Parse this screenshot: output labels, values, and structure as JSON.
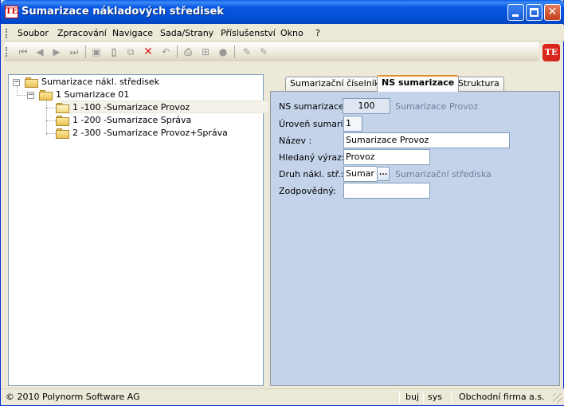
{
  "window": {
    "title": "Sumarizace nákladových středisek",
    "app_icon_text": "TE",
    "buttons": {
      "minimize": "",
      "maximize": "",
      "close": "✕"
    }
  },
  "menu": {
    "items": [
      "Soubor",
      "Zpracování",
      "Navigace",
      "Sada/Strany",
      "Příslušenství",
      "Okno",
      "?"
    ]
  },
  "toolbar": {
    "icons": [
      "first-record-icon",
      "previous-record-icon",
      "next-record-icon",
      "last-record-icon",
      "save-icon",
      "new-document-icon",
      "copy-icon",
      "delete-icon",
      "undo-icon",
      "print-icon",
      "structure-icon",
      "lock-icon",
      "edit-icon",
      "edit-alt-icon"
    ],
    "logo_text": "TE"
  },
  "tree": {
    "root": "Sumarizace nákl. středisek",
    "child": "1 Sumarizace 01",
    "leaves": [
      "1 -100 -Sumarizace Provoz",
      "1 -200 -Sumarizace Správa",
      "2 -300 -Sumarizace Provoz+Správa"
    ]
  },
  "tabs": {
    "items": [
      "Sumarizační číselník",
      "NS sumarizace",
      "Struktura"
    ],
    "active": "NS sumarizace"
  },
  "form": {
    "ns_label": "NS sumarizace:",
    "ns_value": "100",
    "ns_hint": "Sumarizace Provoz",
    "level_label": "Úroveň sumariz.:",
    "level_value": "1",
    "name_label": "Název    :",
    "name_value": "Sumarizace Provoz",
    "search_label": "Hledaný výraz:",
    "search_value": "Provoz",
    "type_label": "Druh nákl. stř.:",
    "type_value": "Sumar",
    "type_button": "...",
    "type_hint": "Sumarizační střediska",
    "resp_label": "Zodpovědný:",
    "resp_value": ""
  },
  "status": {
    "copyright": "© 2010 Polynorm Software AG",
    "user": "buj",
    "db": "sys",
    "company": "Obchodní firma a.s."
  },
  "colors": {
    "titlebar": "#0450d6",
    "form_panel": "#c4d3ea",
    "active_tab_accent": "#e68b2c"
  }
}
